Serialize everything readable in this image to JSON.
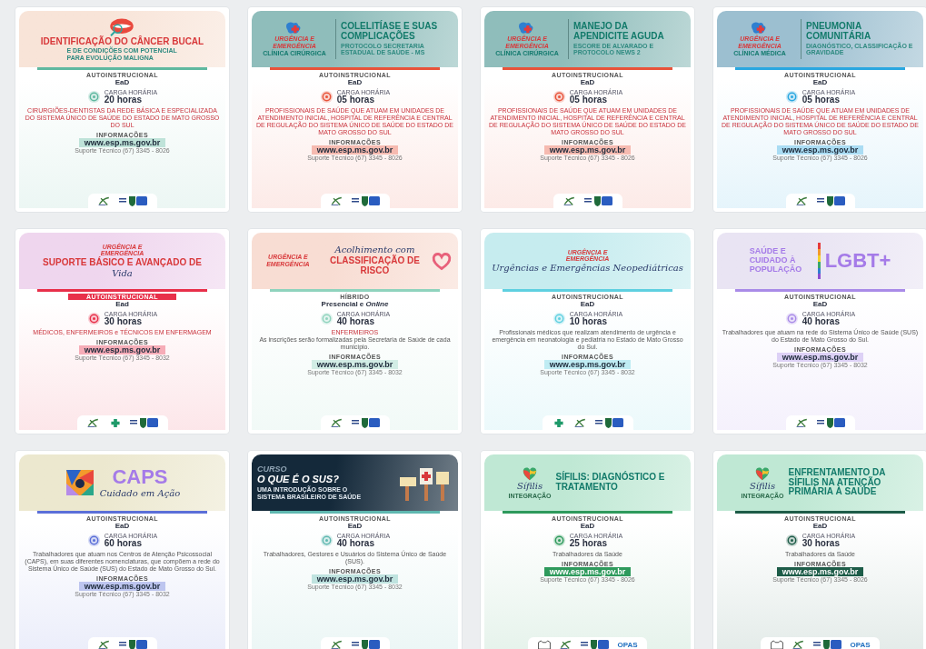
{
  "cards": [
    {
      "color": "#5fb8a0",
      "banner": {
        "kind": "light",
        "color": "#f8e4d8",
        "groups": [
          {
            "items": [
              {
                "kind": "lips"
              },
              {
                "kind": "heading",
                "text": "IDENTIFICAÇÃO DO CÂNCER BUCAL"
              },
              {
                "kind": "subtitle",
                "text": "E DE CONDIÇÕES COM POTENCIAL PARA EVOLUÇÃO MALIGNA"
              }
            ]
          }
        ]
      },
      "mode_label": "AUTOINSTRUCIONAL",
      "mode_label_highlight": false,
      "mode": "EaD",
      "hours_label": "CARGA HORÁRIA",
      "hours": "20 horas",
      "audience": [
        {
          "kind": "alert",
          "text": "CIRURGIÕES-DENTISTAS DA REDE BÁSICA E ESPECIALIZADA DO SISTEMA ÚNICO DE SAÚDE DO ESTADO DE MATO GROSSO DO SUL"
        }
      ],
      "info_label": "INFORMAÇÕES",
      "url": "www.esp.ms.gov.br",
      "url_solid": false,
      "support": "Suporte Técnico (67) 3345 - 8026",
      "logos": [
        {
          "kind": "esp"
        },
        {
          "kind": "gov"
        }
      ]
    },
    {
      "color": "#e8533a",
      "banner": {
        "kind": "light",
        "color": "#8fbdbb",
        "groups": [
          {
            "items": [
              {
                "kind": "emblem"
              },
              {
                "kind": "tag",
                "text": "URGÊNCIA E EMERGÊNCIA"
              },
              {
                "kind": "area",
                "text": "CLÍNICA CIRÚRGICA"
              }
            ]
          },
          {
            "items": [
              {
                "kind": "divider"
              }
            ]
          },
          {
            "items": [
              {
                "kind": "title",
                "text": "COLELITÍASE E SUAS COMPLICAÇÕES"
              },
              {
                "kind": "subtitle",
                "text": "PROTOCOLO SECRETARIA ESTADUAL DE SAÚDE - MS"
              }
            ]
          }
        ]
      },
      "mode_label": "AUTOINSTRUCIONAL",
      "mode_label_highlight": false,
      "mode": "EaD",
      "hours_label": "CARGA HORÁRIA",
      "hours": "05 horas",
      "audience": [
        {
          "kind": "alert",
          "text": "PROFISSIONAIS DE SAÚDE QUE ATUAM EM UNIDADES DE ATENDIMENTO INICIAL, HOSPITAL DE REFERÊNCIA E CENTRAL DE REGULAÇÃO DO SISTEMA ÚNICO DE SAÚDE DO ESTADO DE MATO GROSSO DO SUL"
        }
      ],
      "info_label": "INFORMAÇÕES",
      "url": "www.esp.ms.gov.br",
      "url_solid": false,
      "support": "Suporte Técnico (67) 3345 - 8026",
      "logos": [
        {
          "kind": "esp"
        },
        {
          "kind": "gov"
        }
      ]
    },
    {
      "color": "#e8533a",
      "banner": {
        "kind": "light",
        "color": "#8fbdbb",
        "groups": [
          {
            "items": [
              {
                "kind": "emblem"
              },
              {
                "kind": "tag",
                "text": "URGÊNCIA E EMERGÊNCIA"
              },
              {
                "kind": "area",
                "text": "CLÍNICA CIRÚRGICA"
              }
            ]
          },
          {
            "items": [
              {
                "kind": "divider"
              }
            ]
          },
          {
            "items": [
              {
                "kind": "title",
                "text": "MANEJO DA APENDICITE AGUDA"
              },
              {
                "kind": "subtitle",
                "text": "ESCORE DE ALVARADO E PROTOCOLO NEWS 2"
              }
            ]
          }
        ]
      },
      "mode_label": "AUTOINSTRUCIONAL",
      "mode_label_highlight": false,
      "mode": "EaD",
      "hours_label": "CARGA HORÁRIA",
      "hours": "05 horas",
      "audience": [
        {
          "kind": "alert",
          "text": "PROFISSIONAIS DE SAÚDE QUE ATUAM EM UNIDADES DE ATENDIMENTO INICIAL, HOSPITAL DE REFERÊNCIA E CENTRAL DE REGULAÇÃO DO SISTEMA ÚNICO DE SAÚDE DO ESTADO DE MATO GROSSO DO SUL"
        }
      ],
      "info_label": "INFORMAÇÕES",
      "url": "www.esp.ms.gov.br",
      "url_solid": false,
      "support": "Suporte Técnico (67) 3345 - 8026",
      "logos": [
        {
          "kind": "esp"
        },
        {
          "kind": "gov"
        }
      ]
    },
    {
      "color": "#2aa7e0",
      "banner": {
        "kind": "light",
        "color": "#9cbfd0",
        "groups": [
          {
            "items": [
              {
                "kind": "emblem"
              },
              {
                "kind": "tag",
                "text": "URGÊNCIA E EMERGÊNCIA"
              },
              {
                "kind": "area",
                "text": "CLÍNICA MÉDICA"
              }
            ]
          },
          {
            "items": [
              {
                "kind": "divider"
              }
            ]
          },
          {
            "items": [
              {
                "kind": "title",
                "text": "PNEUMONIA COMUNITÁRIA"
              },
              {
                "kind": "subtitle",
                "text": "DIAGNÓSTICO, CLASSIFICAÇÃO E GRAVIDADE"
              }
            ]
          }
        ]
      },
      "mode_label": "AUTOINSTRUCIONAL",
      "mode_label_highlight": false,
      "mode": "EaD",
      "hours_label": "CARGA HORÁRIA",
      "hours": "05 horas",
      "audience": [
        {
          "kind": "alert",
          "text": "PROFISSIONAIS DE SAÚDE QUE ATUAM EM UNIDADES DE ATENDIMENTO INICIAL, HOSPITAL DE REFERÊNCIA E CENTRAL DE REGULAÇÃO DO SISTEMA ÚNICO DE SAÚDE DO ESTADO DE MATO GROSSO DO SUL"
        }
      ],
      "info_label": "INFORMAÇÕES",
      "url": "www.esp.ms.gov.br",
      "url_solid": false,
      "support": "Suporte Técnico (67) 3345 - 8026",
      "logos": [
        {
          "kind": "esp"
        },
        {
          "kind": "gov"
        }
      ]
    },
    {
      "color": "#e8304a",
      "banner": {
        "kind": "light",
        "color": "#efd6ee",
        "groups": [
          {
            "items": [
              {
                "kind": "tag",
                "text": "URGÊNCIA E EMERGÊNCIA"
              },
              {
                "kind": "heading",
                "text": "SUPORTE BÁSICO E AVANÇADO DE"
              },
              {
                "kind": "script",
                "text": "Vida"
              }
            ]
          }
        ]
      },
      "mode_label": "AUTOINSTRUCIONAL",
      "mode_label_highlight": true,
      "mode": "Ead",
      "hours_label": "CARGA HORÁRIA",
      "hours": "30 horas",
      "audience": [
        {
          "kind": "alert",
          "text": "MÉDICOS, ENFERMEIROS e TÉCNICOS EM ENFERMAGEM"
        }
      ],
      "info_label": "INFORMAÇÕES",
      "url": "www.esp.ms.gov.br",
      "url_solid": false,
      "support": "Suporte Técnico (67) 3345 - 8032",
      "logos": [
        {
          "kind": "esp"
        },
        {
          "kind": "cross"
        },
        {
          "kind": "gov"
        }
      ]
    },
    {
      "color": "#8fd3bd",
      "banner": {
        "kind": "light",
        "color": "#f8ddd3",
        "groups": [
          {
            "items": [
              {
                "kind": "tag",
                "text": "URGÊNCIA E EMERGÊNCIA"
              }
            ]
          },
          {
            "items": [
              {
                "kind": "script",
                "text": "Acolhimento com"
              },
              {
                "kind": "heading",
                "text": "CLASSIFICAÇÃO DE RISCO"
              }
            ]
          },
          {
            "items": [
              {
                "kind": "heart"
              }
            ]
          }
        ]
      },
      "mode_label": "HÍBRIDO",
      "mode_label_highlight": false,
      "mode": "Presencial e *Online*",
      "hours_label": "CARGA HORÁRIA",
      "hours": "40 horas",
      "audience": [
        {
          "kind": "alert",
          "text": "ENFERMEIROS"
        },
        {
          "kind": "plain",
          "text": "As inscrições serão formalizadas pela Secretaria de Saúde de cada município."
        }
      ],
      "info_label": "INFORMAÇÕES",
      "url": "www.esp.ms.gov.br",
      "url_solid": false,
      "support": "Suporte Técnico (67) 3345 - 8032",
      "logos": [
        {
          "kind": "esp"
        },
        {
          "kind": "gov"
        }
      ]
    },
    {
      "color": "#5fd0e0",
      "banner": {
        "kind": "light",
        "color": "#c6ecef",
        "groups": [
          {
            "items": [
              {
                "kind": "tag",
                "text": "URGÊNCIA E EMERGÊNCIA"
              },
              {
                "kind": "script",
                "text": "Urgências e Emergências Neopediátricas"
              }
            ]
          }
        ]
      },
      "mode_label": "AUTOINSTRUCIONAL",
      "mode_label_highlight": false,
      "mode": "EaD",
      "hours_label": "CARGA HORÁRIA",
      "hours": "10 horas",
      "audience": [
        {
          "kind": "plain",
          "text": "Profissionais médicos que realizam atendimento de urgência e emergência em neonatologia e pediatria no Estado de Mato Grosso do Sul."
        }
      ],
      "info_label": "INFORMAÇÕES",
      "url": "www.esp.ms.gov.br",
      "url_solid": false,
      "support": "Suporte Técnico (67) 3345 - 8032",
      "logos": [
        {
          "kind": "cross"
        },
        {
          "kind": "esp"
        },
        {
          "kind": "gov"
        }
      ]
    },
    {
      "color": "#a98be8",
      "banner": {
        "kind": "light",
        "color": "#e9e4f3",
        "groups": [
          {
            "items": [
              {
                "kind": "lead",
                "text": "SAÚDE E CUIDADO À POPULAÇÃO"
              }
            ]
          },
          {
            "items": [
              {
                "kind": "rainbow"
              }
            ]
          },
          {
            "items": [
              {
                "kind": "big",
                "text": "LGBT+"
              }
            ]
          }
        ]
      },
      "mode_label": "AUTOINSTRUCIONAL",
      "mode_label_highlight": false,
      "mode": "EaD",
      "hours_label": "CARGA HORÁRIA",
      "hours": "40 horas",
      "audience": [
        {
          "kind": "plain",
          "text": "Trabalhadores que atuam na rede do Sistema Único de Saúde (SUS) do Estado de Mato Grosso do Sul."
        }
      ],
      "info_label": "INFORMAÇÕES",
      "url": "www.esp.ms.gov.br",
      "url_solid": false,
      "support": "Suporte Técnico (67) 3345 - 8032",
      "logos": [
        {
          "kind": "esp"
        },
        {
          "kind": "gov"
        }
      ]
    },
    {
      "color": "#5b6fd8",
      "banner": {
        "kind": "light",
        "color": "#ece8cf",
        "groups": [
          {
            "items": [
              {
                "kind": "caps"
              }
            ]
          },
          {
            "items": [
              {
                "kind": "big",
                "text": "CAPS"
              },
              {
                "kind": "script",
                "text": "Cuidado em Ação"
              }
            ]
          }
        ]
      },
      "mode_label": "AUTOINSTRUCIONAL",
      "mode_label_highlight": false,
      "mode": "EaD",
      "hours_label": "CARGA HORÁRIA",
      "hours": "60 horas",
      "audience": [
        {
          "kind": "plain",
          "text": "Trabalhadores que atuam nos Centros de Atenção Psicossocial (CAPS), em suas diferentes nomenclaturas, que compõem a rede do Sistema Único de Saúde (SUS) do Estado de Mato Grosso do Sul."
        }
      ],
      "info_label": "INFORMAÇÕES",
      "url": "www.esp.ms.gov.br",
      "url_solid": false,
      "support": "Suporte Técnico (67) 3345 - 8032",
      "logos": [
        {
          "kind": "esp"
        },
        {
          "kind": "gov"
        }
      ]
    },
    {
      "color": "#5fb8b0",
      "banner": {
        "kind": "dark",
        "color": "#14293a",
        "groups": [
          {
            "items": [
              {
                "kind": "outline",
                "text": "CURSO"
              },
              {
                "kind": "title",
                "text": "O QUE É O SUS?"
              },
              {
                "kind": "subtitle",
                "text": "UMA INTRODUÇÃO SOBRE O SISTEMA BRASILEIRO DE SAÚDE"
              }
            ]
          },
          {
            "items": [
              {
                "kind": "signs"
              }
            ]
          }
        ]
      },
      "mode_label": "AUTOINSTRUCIONAL",
      "mode_label_highlight": false,
      "mode": "EaD",
      "hours_label": "CARGA HORÁRIA",
      "hours": "40 horas",
      "audience": [
        {
          "kind": "plain",
          "text": "Trabalhadores, Gestores e Usuários do Sistema Único de Saúde (SUS)."
        }
      ],
      "info_label": "INFORMAÇÕES",
      "url": "www.esp.ms.gov.br",
      "url_solid": false,
      "support": "Suporte Técnico (67) 3345 - 8032",
      "logos": [
        {
          "kind": "esp"
        },
        {
          "kind": "gov"
        }
      ]
    },
    {
      "color": "#2e9a5c",
      "banner": {
        "kind": "light",
        "color": "#bfe8d4",
        "groups": [
          {
            "items": [
              {
                "kind": "sifilis"
              },
              {
                "kind": "script",
                "text": "Sífilis"
              },
              {
                "kind": "small",
                "text": "INTEGRAÇÃO"
              }
            ]
          },
          {
            "items": [
              {
                "kind": "title",
                "text": "SÍFILIS: DIAGNÓSTICO E TRATAMENTO"
              }
            ]
          }
        ]
      },
      "mode_label": "AUTOINSTRUCIONAL",
      "mode_label_highlight": false,
      "mode": "EaD",
      "hours_label": "CARGA HORÁRIA",
      "hours": "25 horas",
      "audience": [
        {
          "kind": "plain",
          "text": "Trabalhadores da Saúde"
        }
      ],
      "info_label": "INFORMAÇÕES",
      "url": "www.esp.ms.gov.br",
      "url_solid": true,
      "support": "Suporte Técnico (67) 3345 - 8026",
      "logos": [
        {
          "kind": "building"
        },
        {
          "kind": "esp"
        },
        {
          "kind": "gov"
        },
        {
          "kind": "opas",
          "text": "OPAS"
        }
      ]
    },
    {
      "color": "#1d5c48",
      "banner": {
        "kind": "light",
        "color": "#bfe8d4",
        "groups": [
          {
            "items": [
              {
                "kind": "sifilis"
              },
              {
                "kind": "script",
                "text": "Sífilis"
              },
              {
                "kind": "small",
                "text": "INTEGRAÇÃO"
              }
            ]
          },
          {
            "items": [
              {
                "kind": "title",
                "text": "ENFRENTAMENTO DA SÍFILIS NA ATENÇÃO PRIMÁRIA À SAÚDE"
              }
            ]
          }
        ]
      },
      "mode_label": "AUTOINSTRUCIONAL",
      "mode_label_highlight": false,
      "mode": "EaD",
      "hours_label": "CARGA HORÁRIA",
      "hours": "30 horas",
      "audience": [
        {
          "kind": "plain",
          "text": "Trabalhadores da Saúde"
        }
      ],
      "info_label": "INFORMAÇÕES",
      "url": "www.esp.ms.gov.br",
      "url_solid": true,
      "support": "Suporte Técnico (67) 3345 - 8026",
      "logos": [
        {
          "kind": "building"
        },
        {
          "kind": "esp"
        },
        {
          "kind": "gov"
        },
        {
          "kind": "opas",
          "text": "OPAS"
        }
      ]
    }
  ]
}
